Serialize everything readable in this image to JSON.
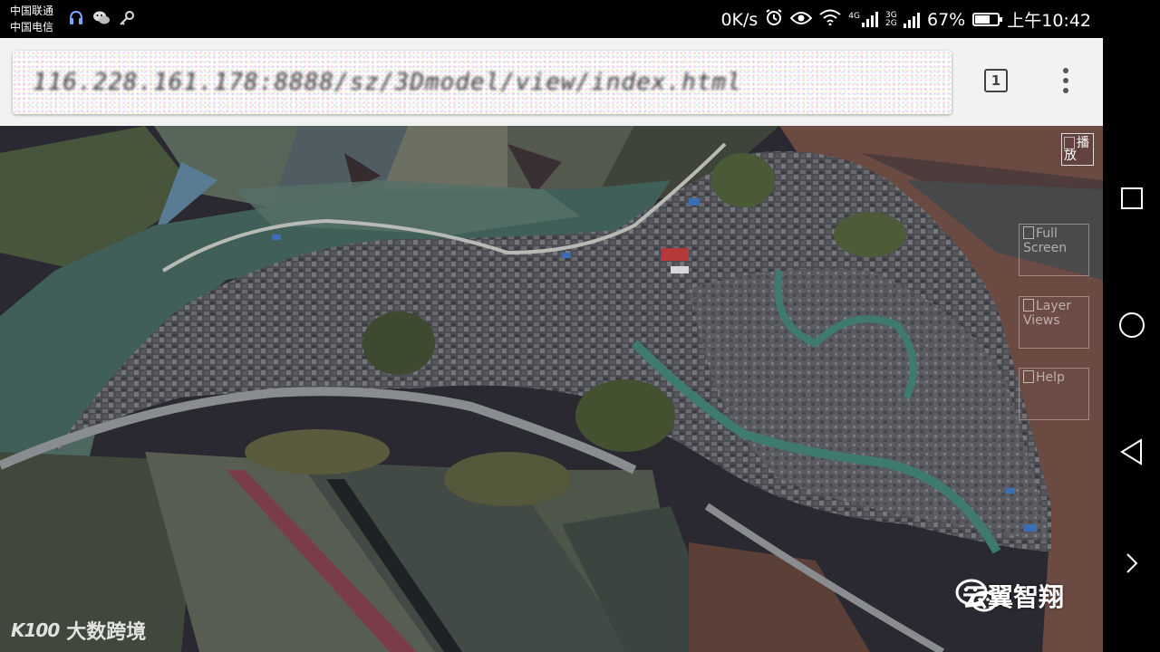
{
  "status_bar": {
    "carrier_1": "中国联通",
    "carrier_2": "中国电信",
    "net_speed": "0K/s",
    "signal_label": "4G",
    "signal2_label": "3G 2G",
    "battery_percent": "67%",
    "battery_level": 0.67,
    "time": "上午10:42",
    "left_icons": [
      "headset-icon",
      "wechat-icon",
      "key-icon"
    ],
    "right_icons": [
      "alarm-icon",
      "eye-icon",
      "wifi-icon",
      "signal-icon",
      "battery-icon"
    ]
  },
  "browser": {
    "url": "116.228.161.178:8888/sz/3Dmodel/view/index.html",
    "tab_count": "1",
    "menu_icon": "more-vert-icon"
  },
  "map": {
    "controls": {
      "corner": {
        "label": "播放",
        "icon": "broken-image-icon"
      },
      "full_screen": {
        "label": "Full Screen",
        "icon": "broken-image-icon"
      },
      "layer_views": {
        "label": "Layer Views",
        "icon": "broken-image-icon"
      },
      "help": {
        "label": "Help",
        "icon": "broken-image-icon"
      }
    }
  },
  "watermarks": {
    "left_logo": "K100",
    "left_text": "大数跨境",
    "right_text": "云翼智翔"
  },
  "nav_bar": {
    "icons": [
      "recents-icon",
      "home-icon",
      "back-icon",
      "expand-icon"
    ]
  },
  "colors": {
    "status_bar_bg": "#000000",
    "toolbar_bg": "#f2f2f2",
    "canal": "#3f7a70",
    "terrain_brown": "#6b4a42"
  }
}
